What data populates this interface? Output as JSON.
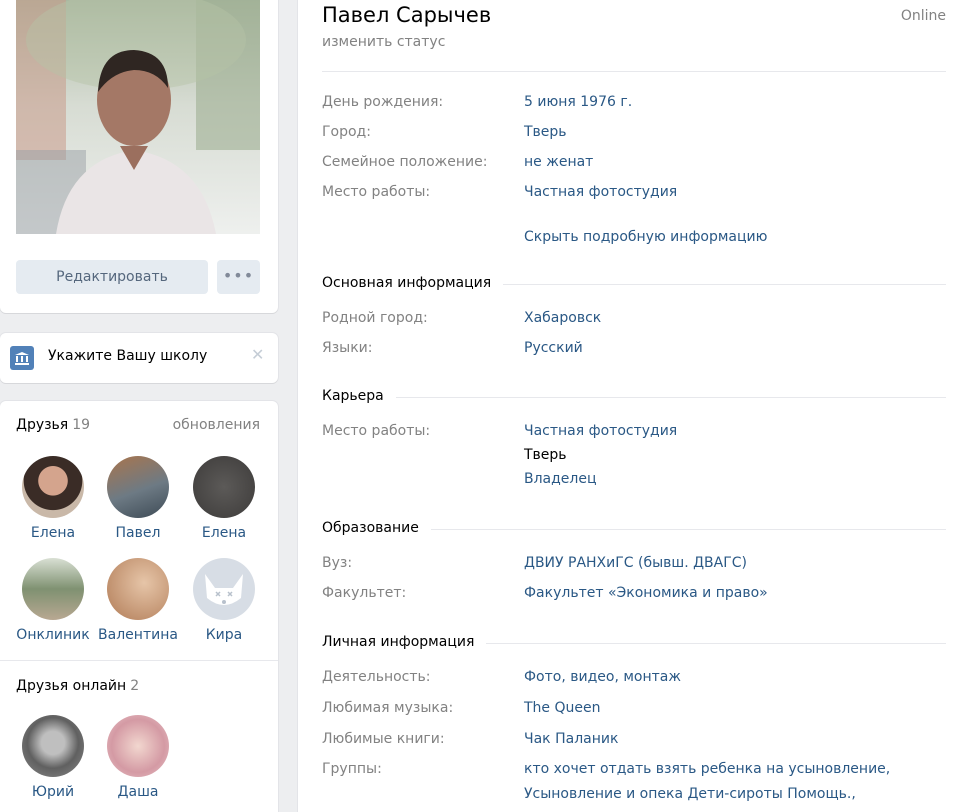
{
  "left": {
    "edit_button": "Редактировать",
    "more_button": "•••",
    "school_prompt": "Укажите Вашу школу",
    "school_close": "✕",
    "friends": {
      "title": "Друзья",
      "count": "19",
      "updates_link": "обновления",
      "items": [
        {
          "name": "Елена"
        },
        {
          "name": "Павел"
        },
        {
          "name": "Елена"
        },
        {
          "name": "Онклиник"
        },
        {
          "name": "Валентина"
        },
        {
          "name": "Кира"
        }
      ]
    },
    "friends_online": {
      "title": "Друзья онлайн",
      "count": "2",
      "items": [
        {
          "name": "Юрий"
        },
        {
          "name": "Даша"
        }
      ]
    }
  },
  "profile": {
    "name": "Павел Сарычев",
    "status_prompt": "изменить статус",
    "online": "Online",
    "short_info": [
      {
        "label": "День рождения:",
        "value": "5 июня 1976 г."
      },
      {
        "label": "Город:",
        "value": "Тверь"
      },
      {
        "label": "Семейное положение:",
        "value": "не женат"
      },
      {
        "label": "Место работы:",
        "value": "Частная фотостудия"
      }
    ],
    "hide_details_link": "Скрыть подробную информацию",
    "sections": {
      "basic": {
        "title": "Основная информация",
        "rows": [
          {
            "label": "Родной город:",
            "value": "Хабаровск"
          },
          {
            "label": "Языки:",
            "value": "Русский"
          }
        ]
      },
      "career": {
        "title": "Карьера",
        "label": "Место работы:",
        "company": "Частная фотостудия",
        "city": "Тверь",
        "position": "Владелец"
      },
      "education": {
        "title": "Образование",
        "rows": [
          {
            "label": "Вуз:",
            "value": "ДВИУ РАНХиГС (бывш. ДВАГС)"
          },
          {
            "label": "Факультет:",
            "value": "Факультет «Экономика и право»"
          }
        ]
      },
      "personal": {
        "title": "Личная информация",
        "rows": [
          {
            "label": "Деятельность:",
            "value": "Фото, видео, монтаж"
          },
          {
            "label": "Любимая музыка:",
            "value": "The Queen"
          },
          {
            "label": "Любимые книги:",
            "value": "Чак Паланик"
          },
          {
            "label": "Группы:",
            "value": "кто хочет отдать взять ребенка на усыновление,"
          }
        ],
        "groups_line2": "Усыновление и опека Дети-сироты Помощь.,"
      }
    }
  },
  "colors": {
    "link": "#2a5885",
    "muted": "#828282",
    "accent": "#5181b8",
    "background": "#edeef0"
  }
}
